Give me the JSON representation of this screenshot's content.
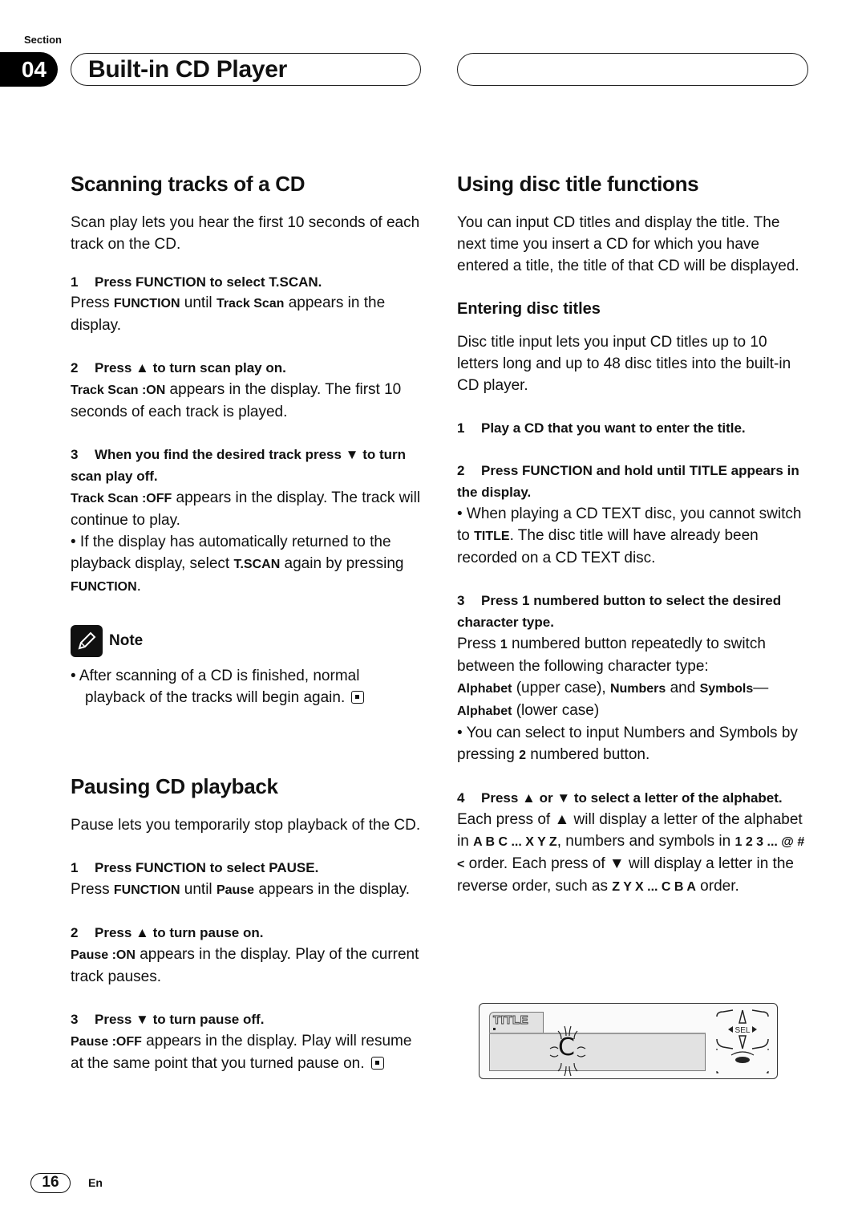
{
  "header": {
    "section_label": "Section",
    "section_number": "04",
    "chapter_title": "Built-in CD Player"
  },
  "left": {
    "scan": {
      "heading": "Scanning tracks of a CD",
      "intro": "Scan play lets you hear the first 10 seconds of each track on the CD.",
      "steps": [
        {
          "num": "1",
          "title": "Press FUNCTION to select T.SCAN.",
          "body_parts": [
            "Press ",
            "FUNCTION",
            " until ",
            "Track Scan",
            " appears in the display."
          ]
        },
        {
          "num": "2",
          "title": "Press ▲ to turn scan play on.",
          "body_parts": [
            "Track Scan :ON",
            " appears in the display. The first 10 seconds of each track is played."
          ]
        },
        {
          "num": "3",
          "title": "When you find the desired track press ▼ to turn scan play off.",
          "body_parts": [
            "Track Scan :OFF",
            " appears in the display. The track will continue to play."
          ],
          "bullet_parts": [
            "• If the display has automatically returned to the playback display, select ",
            "T.SCAN",
            " again by pressing ",
            "FUNCTION",
            "."
          ]
        }
      ],
      "note": {
        "label": "Note",
        "text": "• After scanning of a CD is finished, normal playback of the tracks will begin again."
      }
    },
    "pause": {
      "heading": "Pausing CD playback",
      "intro": "Pause lets you temporarily stop playback of the CD.",
      "steps": [
        {
          "num": "1",
          "title": "Press FUNCTION to select PAUSE.",
          "body_parts": [
            "Press ",
            "FUNCTION",
            " until ",
            "Pause",
            " appears in the display."
          ]
        },
        {
          "num": "2",
          "title": "Press ▲ to turn pause on.",
          "body_parts": [
            "Pause :ON",
            " appears in the display. Play of the current track pauses."
          ]
        },
        {
          "num": "3",
          "title": "Press ▼ to turn pause off.",
          "body_parts": [
            "Pause :OFF",
            " appears in the display. Play will resume at the same point that you turned pause on."
          ]
        }
      ]
    }
  },
  "right": {
    "heading": "Using disc title functions",
    "intro": "You can input CD titles and display the title. The next time you insert a CD for which you have entered a title, the title of that CD will be displayed.",
    "subheading": "Entering disc titles",
    "sub_intro": "Disc title input lets you input CD titles up to 10 letters long and up to 48 disc titles into the built-in CD player.",
    "steps": [
      {
        "num": "1",
        "title": "Play a CD that you want to enter the title."
      },
      {
        "num": "2",
        "title": "Press FUNCTION and hold until TITLE appears in the display.",
        "bullet_parts": [
          "• When playing a CD TEXT disc, you cannot switch to ",
          "TITLE",
          ". The disc title will have already been recorded on a CD TEXT disc."
        ]
      },
      {
        "num": "3",
        "title": "Press 1 numbered button to select the desired character type.",
        "body_parts": [
          "Press ",
          "1",
          " numbered button repeatedly to switch between the following character type:"
        ],
        "types_parts": [
          "Alphabet",
          " (upper case), ",
          "Numbers",
          " and ",
          "Symbols",
          "—",
          "Alphabet",
          " (lower case)"
        ],
        "bullet_parts": [
          "• You can select to input Numbers and Symbols by pressing ",
          "2",
          " numbered button."
        ]
      },
      {
        "num": "4",
        "title": "Press ▲ or ▼ to select a letter of the alphabet.",
        "body_parts": [
          "Each press of ▲ will display a letter of the alphabet in ",
          "A B C ... X Y Z",
          ", numbers and symbols in ",
          "1 2 3 ... @ # <",
          " order. Each press of ▼ will display a letter in the reverse order, such as ",
          "Z Y X ... C B A",
          " order."
        ]
      }
    ],
    "display": {
      "tab_label": "TITLE",
      "current_char": "C",
      "select_label": "SEL"
    }
  },
  "footer": {
    "page_number": "16",
    "language": "En"
  }
}
